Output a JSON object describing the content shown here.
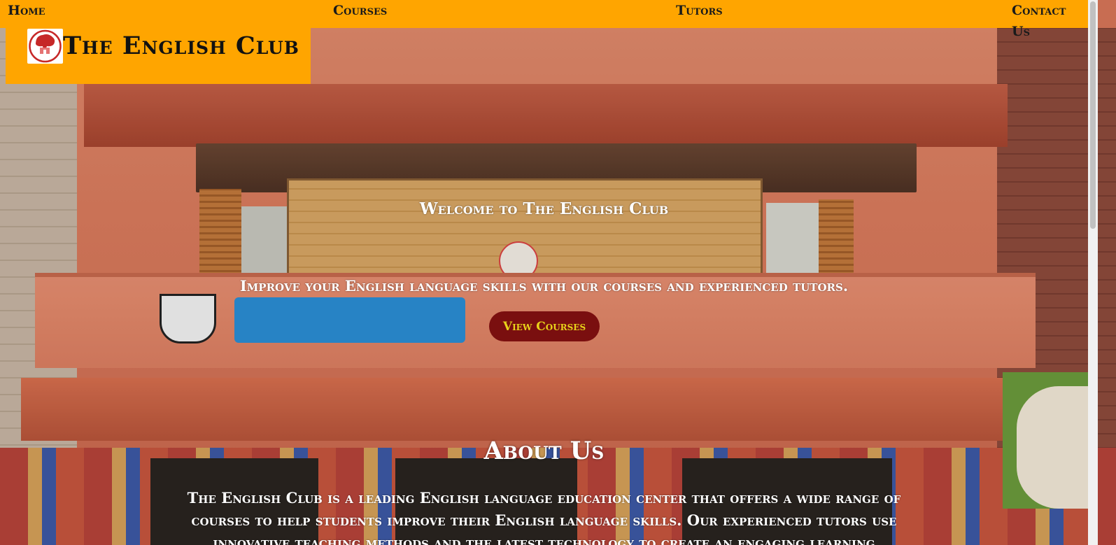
{
  "nav": {
    "home": "Home",
    "courses": "Courses",
    "tutors": "Tutors",
    "contact": "Contact Us"
  },
  "brand": {
    "title": "The English Club",
    "logo_icon": "english-club-logo",
    "logo_caption": "The English Club"
  },
  "hero": {
    "title": "Welcome to The English Club",
    "subtitle": "Improve your English language skills with our courses and experienced tutors.",
    "button": "View Courses"
  },
  "about": {
    "title": "About Us",
    "text": "The English Club is a leading English language education center that offers a wide range of courses to help students improve their English language skills. Our experienced tutors use innovative teaching methods and the latest technology to create an engaging learning"
  },
  "colors": {
    "nav_bg": "#ffa500",
    "button_bg": "#7a0f0f",
    "button_text": "#e8d21a"
  }
}
